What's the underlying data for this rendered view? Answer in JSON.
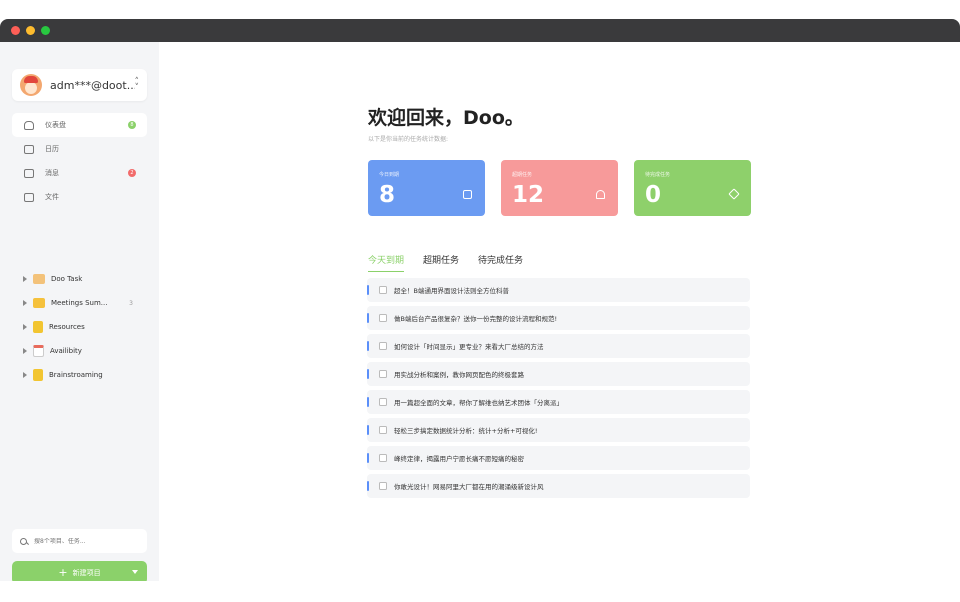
{
  "sidebar": {
    "account": {
      "email": "adm***@doot..."
    },
    "nav": [
      {
        "label": "仪表盘",
        "badge": "8",
        "badge_color": "#8bd16a",
        "active": true,
        "icon": "dashboard-icon"
      },
      {
        "label": "日历",
        "badge": "",
        "icon": "calendar-icon"
      },
      {
        "label": "消息",
        "badge": "2",
        "badge_color": "#f26b6b",
        "icon": "message-icon"
      },
      {
        "label": "文件",
        "badge": "",
        "icon": "file-icon"
      }
    ],
    "projects": [
      {
        "label": "Doo Task",
        "count": "",
        "color": "#f3c27a"
      },
      {
        "label": "Meetings Sum...",
        "count": "3",
        "color": "#f5c13c"
      },
      {
        "label": "Resources",
        "count": "",
        "color": "#f2c531"
      },
      {
        "label": "Availibity",
        "count": "",
        "color": "#e86b5c"
      },
      {
        "label": "Brainstroaming",
        "count": "",
        "color": "#f2c531"
      }
    ],
    "search": {
      "placeholder": "搜8个项目、任务..."
    },
    "new_button": {
      "label": "新建项目"
    }
  },
  "main": {
    "greeting": "欢迎回来，Doo。",
    "subtitle": "以下是你当前的任务统计数据:",
    "cards": [
      {
        "label": "今日到期",
        "value": "8",
        "color": "#6b9bf2",
        "icon": "calendar-check-icon"
      },
      {
        "label": "超期任务",
        "value": "12",
        "color": "#f79a9a",
        "icon": "bell-icon"
      },
      {
        "label": "待完成任务",
        "value": "0",
        "color": "#8ed06b",
        "icon": "layers-icon"
      }
    ],
    "tabs": [
      {
        "label": "今天到期",
        "active": true
      },
      {
        "label": "超期任务",
        "active": false
      },
      {
        "label": "待完成任务",
        "active": false
      }
    ],
    "tasks": [
      "超全！B端通用界面设计法则全方位科普",
      "做B端后台产品很复杂？送你一份完整的设计流程和规范!",
      "如何设计「时间显示」更专业？来看大厂总结的方法",
      "用实战分析和案例，教你网页配色的终极套路",
      "用一篇超全面的文章，帮你了解维也纳艺术团体「分离派」",
      "轻松三步搞定数据统计分析：统计+分析+可视化!",
      "峰终定律，揭露用户宁愿长痛不愿短痛的秘密",
      "你敢光设计！网易阿里大厂都在用的潮涌级新设计风"
    ]
  },
  "colors": {
    "accent": "#8bd16a",
    "titlebar": "#3a3a3c"
  }
}
